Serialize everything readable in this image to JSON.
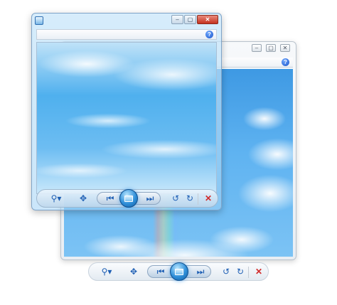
{
  "back_window": {
    "controls": {
      "minimize": "–",
      "maximize": "▢",
      "close": "✕"
    },
    "help": "?"
  },
  "front_window": {
    "controls": {
      "minimize": "–",
      "maximize": "▢",
      "close": "✕"
    },
    "help": "?"
  },
  "toolbar": {
    "zoom": "⚲▾",
    "actual_size": "✥",
    "previous": "⏮",
    "next": "⏭",
    "rotate_ccw": "↺",
    "rotate_cw": "↻",
    "delete": "✕"
  },
  "colors": {
    "sky_blue": "#4fb0ee",
    "accent_blue": "#1e5fb4",
    "close_red": "#c4321f",
    "delete_red": "#d12a2a"
  }
}
